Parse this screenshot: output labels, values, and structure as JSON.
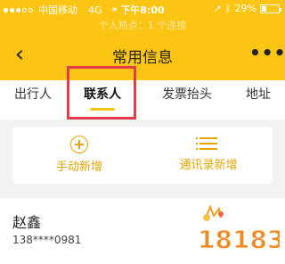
{
  "status_bar": {
    "carrier": "中国移动",
    "network": "4G",
    "time": "下午8:00",
    "battery": "29%",
    "battery_level": 0.29
  },
  "hotspot_banner": "个人热点：1 个连接",
  "navbar": {
    "back_icon": "chevron-left-icon",
    "title": "常用信息",
    "more_icon": "more-dots-icon",
    "more_label": "•••"
  },
  "tabs": [
    {
      "label": "出行人",
      "active": false
    },
    {
      "label": "联系人",
      "active": true
    },
    {
      "label": "发票抬头",
      "active": false
    },
    {
      "label": "地址",
      "active": false
    }
  ],
  "actions": {
    "manual_add": {
      "label": "手动新增",
      "icon": "plus-circle-icon"
    },
    "contacts_add": {
      "label": "通讯录新增",
      "icon": "list-icon"
    }
  },
  "contact": {
    "name": "赵鑫",
    "phone": "138****0981"
  },
  "watermark": "18183",
  "colors": {
    "accent_yellow": "#fcc513",
    "action_text": "#e2a500",
    "highlight_red": "#e23b4a"
  }
}
